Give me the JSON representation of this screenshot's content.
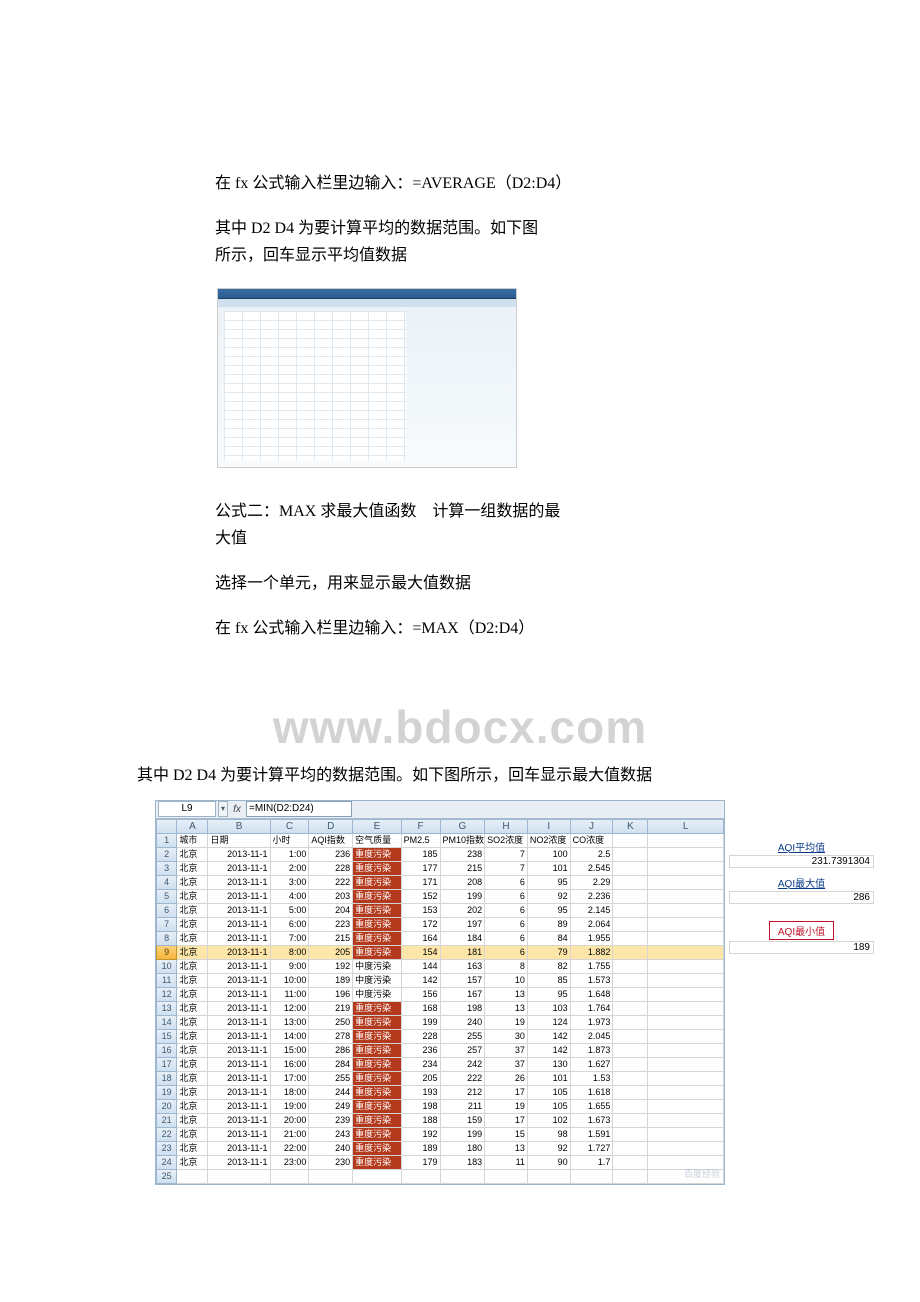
{
  "paragraphs": {
    "p1": "在 fx 公式输入栏里边输入：=AVERAGE（D2:D4）",
    "p2a": "其中 D2 D4 为要计算平均的数据范围。如下图",
    "p2b": "所示，回车显示平均值数据",
    "p3a": "公式二：MAX 求最大值函数　计算一组数据的最",
    "p3b": "大值",
    "p4": "选择一个单元，用来显示最大值数据",
    "p5": "在 fx 公式输入栏里边输入：=MAX（D2:D4）",
    "p6": "其中 D2 D4 为要计算平均的数据范围。如下图所示，回车显示最大值数据"
  },
  "watermark": "www.bdocx.com",
  "excel": {
    "namebox": "L9",
    "fx": "fx",
    "formula": "=MIN(D2:D24)",
    "dd": "▾",
    "cols": [
      "A",
      "B",
      "C",
      "D",
      "E",
      "F",
      "G",
      "H",
      "I",
      "J",
      "K",
      "L"
    ],
    "headers": [
      "城市",
      "日期",
      "小时",
      "AQI指数",
      "空气质量",
      "PM2.5",
      "PM10指数",
      "SO2浓度",
      "NO2浓度",
      "CO浓度"
    ],
    "annot_avg_label": "AQI平均值",
    "annot_avg_val": "231.7391304",
    "annot_max_label": "AQI最大值",
    "annot_max_val": "286",
    "annot_min_label": "AQI最小值",
    "annot_min_val": "189",
    "wm2": "百度经验",
    "rows": [
      {
        "n": 1
      },
      {
        "n": 2,
        "a": "北京",
        "b": "2013-11-1",
        "c": "1:00",
        "d": "236",
        "e": "重度污染",
        "f": "185",
        "g": "238",
        "h": "7",
        "i": "100",
        "j": "2.5"
      },
      {
        "n": 3,
        "a": "北京",
        "b": "2013-11-1",
        "c": "2:00",
        "d": "228",
        "e": "重度污染",
        "f": "177",
        "g": "215",
        "h": "7",
        "i": "101",
        "j": "2.545"
      },
      {
        "n": 4,
        "a": "北京",
        "b": "2013-11-1",
        "c": "3:00",
        "d": "222",
        "e": "重度污染",
        "f": "171",
        "g": "208",
        "h": "6",
        "i": "95",
        "j": "2.29"
      },
      {
        "n": 5,
        "a": "北京",
        "b": "2013-11-1",
        "c": "4:00",
        "d": "203",
        "e": "重度污染",
        "f": "152",
        "g": "199",
        "h": "6",
        "i": "92",
        "j": "2.236"
      },
      {
        "n": 6,
        "a": "北京",
        "b": "2013-11-1",
        "c": "5:00",
        "d": "204",
        "e": "重度污染",
        "f": "153",
        "g": "202",
        "h": "6",
        "i": "95",
        "j": "2.145"
      },
      {
        "n": 7,
        "a": "北京",
        "b": "2013-11-1",
        "c": "6:00",
        "d": "223",
        "e": "重度污染",
        "f": "172",
        "g": "197",
        "h": "6",
        "i": "89",
        "j": "2.064"
      },
      {
        "n": 8,
        "a": "北京",
        "b": "2013-11-1",
        "c": "7:00",
        "d": "215",
        "e": "重度污染",
        "f": "164",
        "g": "184",
        "h": "6",
        "i": "84",
        "j": "1.955"
      },
      {
        "n": 9,
        "a": "北京",
        "b": "2013-11-1",
        "c": "8:00",
        "d": "205",
        "e": "重度污染",
        "f": "154",
        "g": "181",
        "h": "6",
        "i": "79",
        "j": "1.882",
        "sel": true
      },
      {
        "n": 10,
        "a": "北京",
        "b": "2013-11-1",
        "c": "9:00",
        "d": "192",
        "e": "中度污染",
        "f": "144",
        "g": "163",
        "h": "8",
        "i": "82",
        "j": "1.755"
      },
      {
        "n": 11,
        "a": "北京",
        "b": "2013-11-1",
        "c": "10:00",
        "d": "189",
        "e": "中度污染",
        "f": "142",
        "g": "157",
        "h": "10",
        "i": "85",
        "j": "1.573"
      },
      {
        "n": 12,
        "a": "北京",
        "b": "2013-11-1",
        "c": "11:00",
        "d": "196",
        "e": "中度污染",
        "f": "156",
        "g": "167",
        "h": "13",
        "i": "95",
        "j": "1.648"
      },
      {
        "n": 13,
        "a": "北京",
        "b": "2013-11-1",
        "c": "12:00",
        "d": "219",
        "e": "重度污染",
        "f": "168",
        "g": "198",
        "h": "13",
        "i": "103",
        "j": "1.764"
      },
      {
        "n": 14,
        "a": "北京",
        "b": "2013-11-1",
        "c": "13:00",
        "d": "250",
        "e": "重度污染",
        "f": "199",
        "g": "240",
        "h": "19",
        "i": "124",
        "j": "1.973"
      },
      {
        "n": 15,
        "a": "北京",
        "b": "2013-11-1",
        "c": "14:00",
        "d": "278",
        "e": "重度污染",
        "f": "228",
        "g": "255",
        "h": "30",
        "i": "142",
        "j": "2.045"
      },
      {
        "n": 16,
        "a": "北京",
        "b": "2013-11-1",
        "c": "15:00",
        "d": "286",
        "e": "重度污染",
        "f": "236",
        "g": "257",
        "h": "37",
        "i": "142",
        "j": "1.873"
      },
      {
        "n": 17,
        "a": "北京",
        "b": "2013-11-1",
        "c": "16:00",
        "d": "284",
        "e": "重度污染",
        "f": "234",
        "g": "242",
        "h": "37",
        "i": "130",
        "j": "1.627"
      },
      {
        "n": 18,
        "a": "北京",
        "b": "2013-11-1",
        "c": "17:00",
        "d": "255",
        "e": "重度污染",
        "f": "205",
        "g": "222",
        "h": "26",
        "i": "101",
        "j": "1.53"
      },
      {
        "n": 19,
        "a": "北京",
        "b": "2013-11-1",
        "c": "18:00",
        "d": "244",
        "e": "重度污染",
        "f": "193",
        "g": "212",
        "h": "17",
        "i": "105",
        "j": "1.618"
      },
      {
        "n": 20,
        "a": "北京",
        "b": "2013-11-1",
        "c": "19:00",
        "d": "249",
        "e": "重度污染",
        "f": "198",
        "g": "211",
        "h": "19",
        "i": "105",
        "j": "1.655"
      },
      {
        "n": 21,
        "a": "北京",
        "b": "2013-11-1",
        "c": "20:00",
        "d": "239",
        "e": "重度污染",
        "f": "188",
        "g": "159",
        "h": "17",
        "i": "102",
        "j": "1.673"
      },
      {
        "n": 22,
        "a": "北京",
        "b": "2013-11-1",
        "c": "21:00",
        "d": "243",
        "e": "重度污染",
        "f": "192",
        "g": "199",
        "h": "15",
        "i": "98",
        "j": "1.591"
      },
      {
        "n": 23,
        "a": "北京",
        "b": "2013-11-1",
        "c": "22:00",
        "d": "240",
        "e": "重度污染",
        "f": "189",
        "g": "180",
        "h": "13",
        "i": "92",
        "j": "1.727"
      },
      {
        "n": 24,
        "a": "北京",
        "b": "2013-11-1",
        "c": "23:00",
        "d": "230",
        "e": "重度污染",
        "f": "179",
        "g": "183",
        "h": "11",
        "i": "90",
        "j": "1.7"
      },
      {
        "n": 25
      }
    ]
  }
}
